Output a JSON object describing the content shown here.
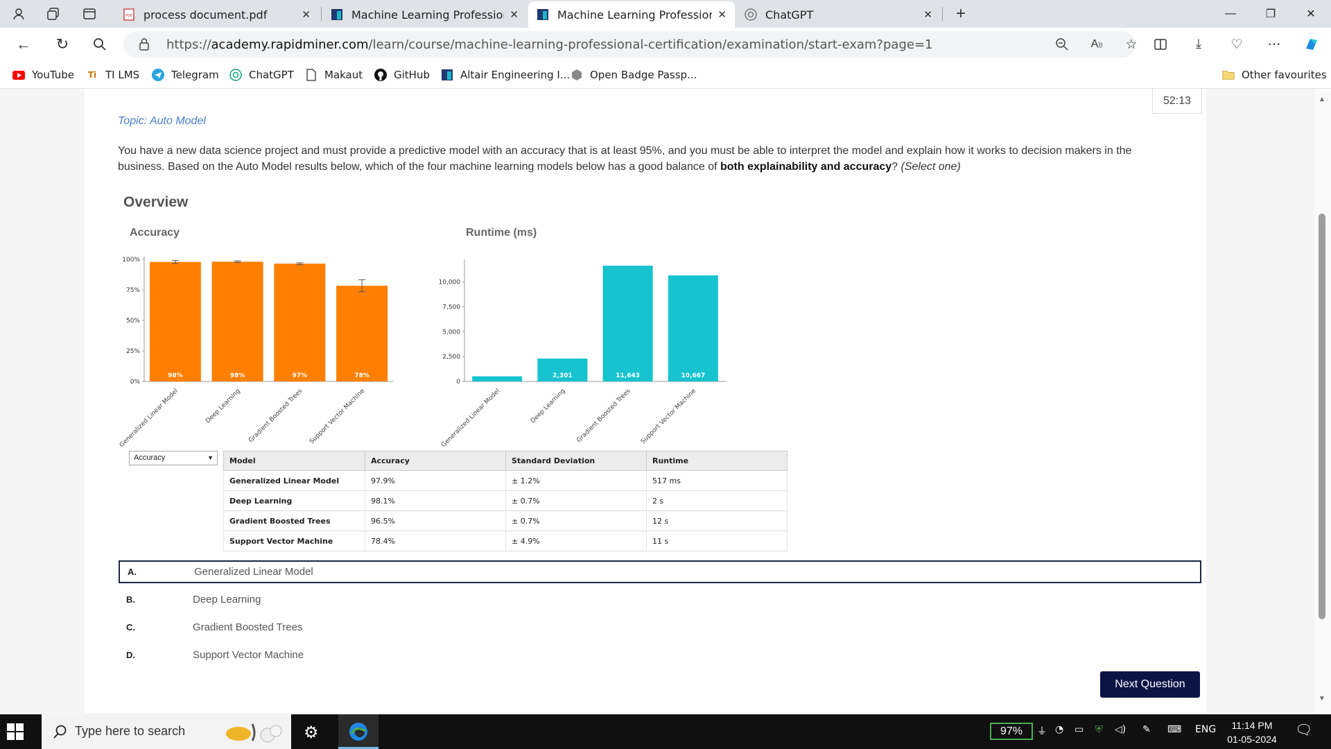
{
  "browser": {
    "tabs": [
      {
        "title": "process document.pdf",
        "active": false
      },
      {
        "title": "Machine Learning Professional -",
        "active": false
      },
      {
        "title": "Machine Learning Professional C",
        "active": true
      },
      {
        "title": "ChatGPT",
        "active": false
      }
    ],
    "url_prefix": "https://",
    "url_domain": "academy.rapidminer.com",
    "url_path": "/learn/course/machine-learning-professional-certification/examination/start-exam?page=1",
    "bookmarks": [
      "YouTube",
      "TI LMS",
      "Telegram",
      "ChatGPT",
      "Makaut",
      "GitHub",
      "Altair Engineering I...",
      "Open Badge Passp..."
    ],
    "other_favourites": "Other favourites"
  },
  "exam": {
    "timer": "52:13",
    "topic": "Topic: Auto Model",
    "question_part1": "You have a new data science project and must provide a predictive model with an accuracy that is at least 95%, and  you must be able to interpret the model and explain how it works to decision makers in the business. Based on the Auto Model results below, which of the four machine learning models below has  a good balance of ",
    "question_bold": "both explainability and accuracy",
    "question_part2": "? ",
    "question_hint": "(Select one)",
    "overview_title": "Overview",
    "metric_select": "Accuracy",
    "options": [
      {
        "letter": "A.",
        "text": "Generalized Linear Model",
        "selected": true
      },
      {
        "letter": "B.",
        "text": "Deep Learning",
        "selected": false
      },
      {
        "letter": "C.",
        "text": "Gradient Boosted Trees",
        "selected": false
      },
      {
        "letter": "D.",
        "text": "Support Vector Machine",
        "selected": false
      }
    ],
    "next_button": "Next Question"
  },
  "table": {
    "headers": [
      "Model",
      "Accuracy",
      "Standard Deviation",
      "Runtime"
    ],
    "rows": [
      [
        "Generalized Linear Model",
        "97.9%",
        "± 1.2%",
        "517 ms"
      ],
      [
        "Deep Learning",
        "98.1%",
        "± 0.7%",
        "2 s"
      ],
      [
        "Gradient Boosted Trees",
        "96.5%",
        "± 0.7%",
        "12 s"
      ],
      [
        "Support Vector Machine",
        "78.4%",
        "± 4.9%",
        "11 s"
      ]
    ]
  },
  "chart_data": [
    {
      "type": "bar",
      "title": "Accuracy",
      "categories": [
        "Generalized Linear Model",
        "Deep Learning",
        "Gradient Boosted Trees",
        "Support Vector Machine"
      ],
      "values": [
        97.9,
        98.1,
        96.5,
        78.4
      ],
      "error": [
        1.2,
        0.7,
        0.7,
        4.9
      ],
      "data_labels": [
        "98%",
        "98%",
        "97%",
        "78%"
      ],
      "yticks": [
        "0%",
        "25%",
        "50%",
        "75%",
        "100%"
      ],
      "ylim": [
        0,
        100
      ],
      "color": "#ff7f00"
    },
    {
      "type": "bar",
      "title": "Runtime (ms)",
      "categories": [
        "Generalized Linear Model",
        "Deep Learning",
        "Gradient Boosted Trees",
        "Support Vector Machine"
      ],
      "values": [
        517,
        2301,
        11643,
        10667
      ],
      "data_labels": [
        "",
        "2,301",
        "11,643",
        "10,667"
      ],
      "yticks": [
        "0",
        "2,500",
        "5,000",
        "7,500",
        "10,000"
      ],
      "ylim": [
        0,
        12000
      ],
      "color": "#17c3cf"
    }
  ],
  "taskbar": {
    "search_placeholder": "Type here to search",
    "battery": "97%",
    "language": "ENG",
    "time": "11:14 PM",
    "date": "01-05-2024"
  }
}
